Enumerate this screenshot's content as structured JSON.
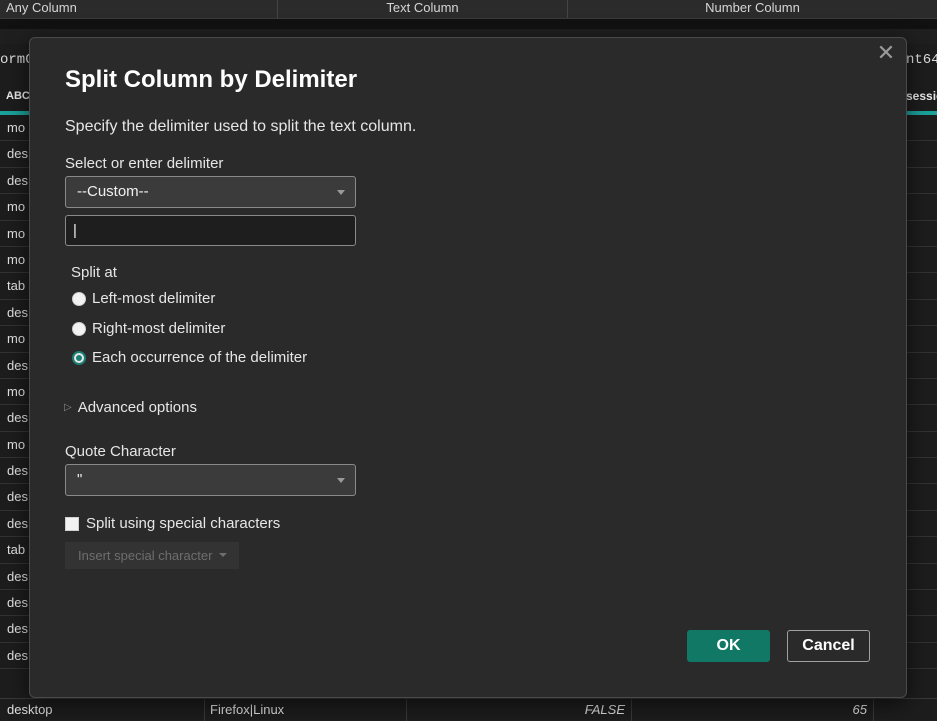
{
  "background": {
    "ribbon_tabs": [
      "Any Column",
      "Text Column",
      "Number Column"
    ],
    "left_fragment": "ormC",
    "right_fragment": "nt64",
    "left_header": "ABC",
    "right_header": "sessio",
    "left_cells": [
      "mo",
      "des",
      "des",
      "mo",
      "mo",
      "mo",
      "tab",
      "des",
      "mo",
      "des",
      "mo",
      "des",
      "mo",
      "des",
      "des",
      "des",
      "tab",
      "des",
      "des",
      "des",
      "des"
    ],
    "bottom_row": {
      "device": "desktop",
      "browser": "Firefox|Linux",
      "flag": "FALSE",
      "number": "65"
    }
  },
  "dialog": {
    "title": "Split Column by Delimiter",
    "description": "Specify the delimiter used to split the text column.",
    "delimiter_label": "Select or enter delimiter",
    "delimiter_selected": "--Custom--",
    "custom_value": "|",
    "split_at_label": "Split at",
    "split_options": [
      "Left-most delimiter",
      "Right-most delimiter",
      "Each occurrence of the delimiter"
    ],
    "split_selected_index": 2,
    "advanced_label": "Advanced options",
    "quote_label": "Quote Character",
    "quote_selected": "\"",
    "special_chars_label": "Split using special characters",
    "special_chars_checked": false,
    "insert_special_label": "Insert special character",
    "ok_label": "OK",
    "cancel_label": "Cancel",
    "accent_color": "#117865"
  }
}
